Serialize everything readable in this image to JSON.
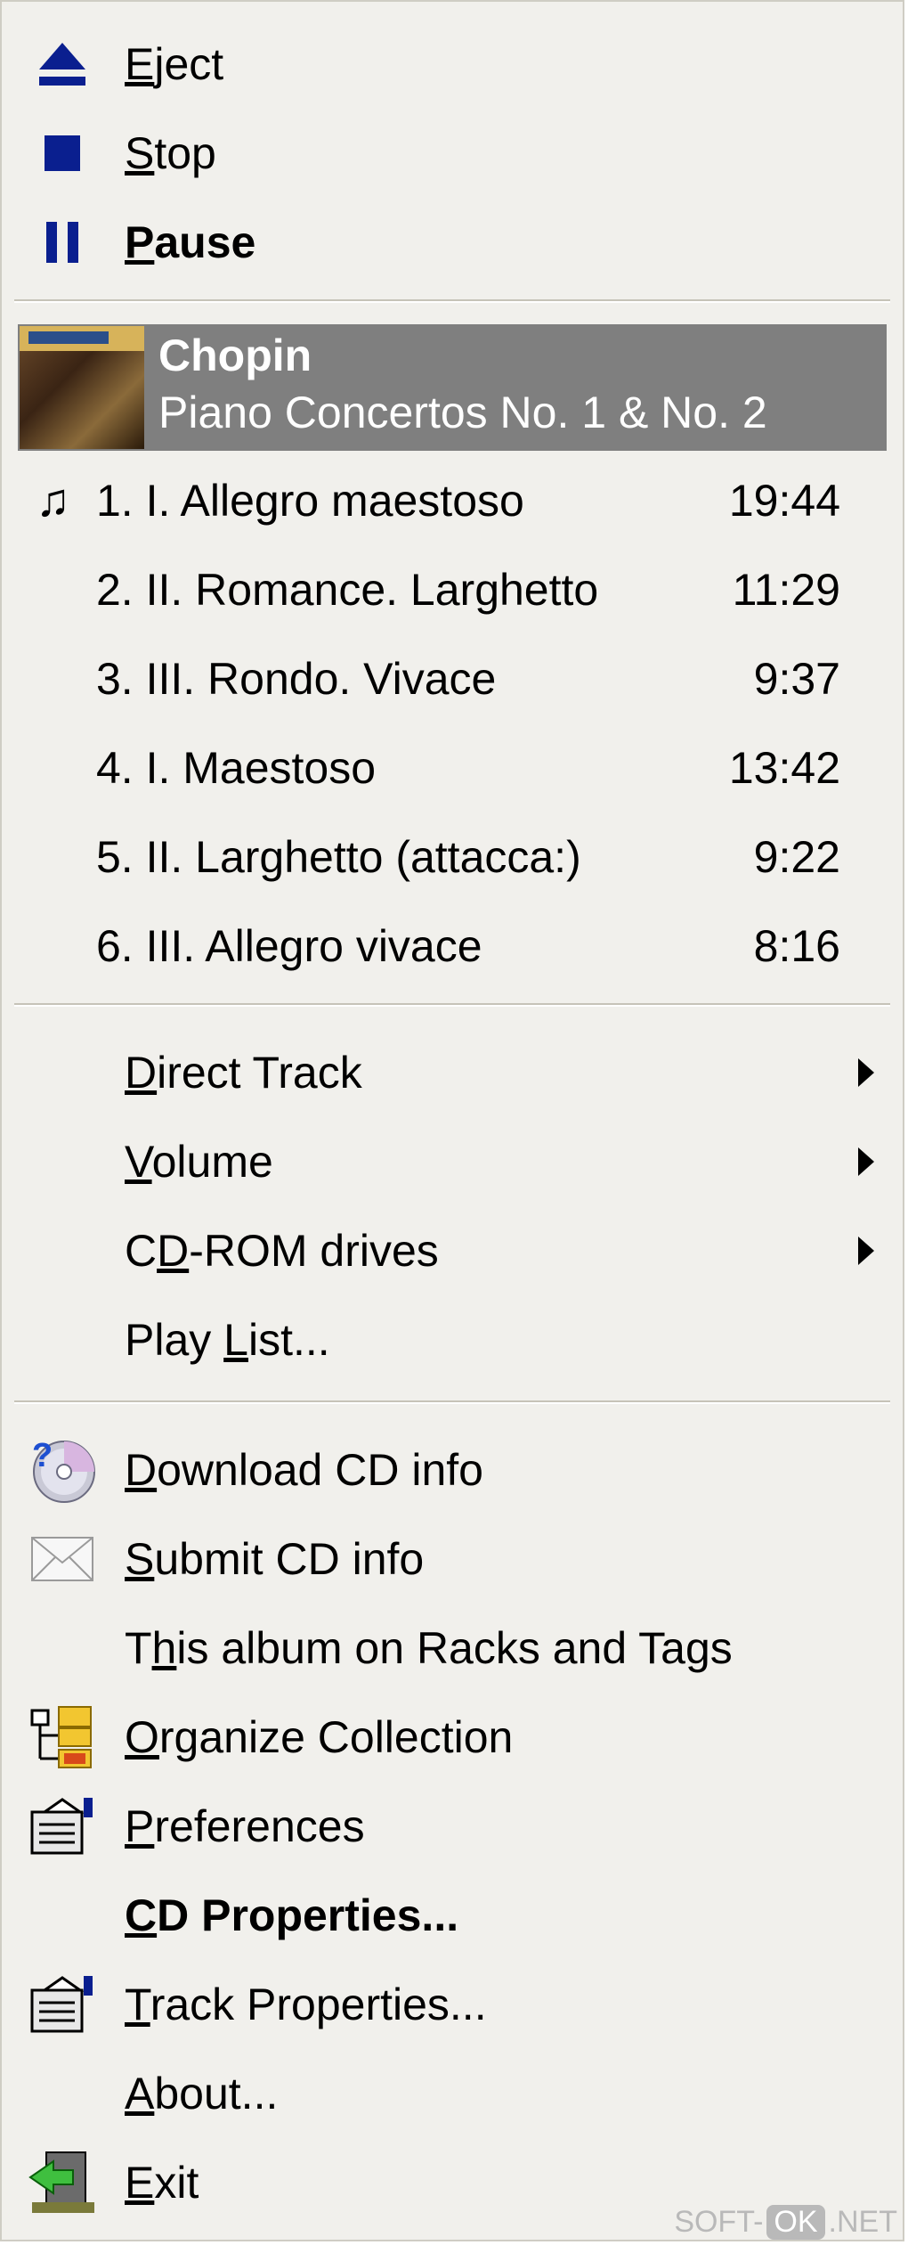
{
  "transport": {
    "eject": {
      "pre": "",
      "key": "E",
      "post": "ject"
    },
    "stop": {
      "pre": "",
      "key": "S",
      "post": "top"
    },
    "pause": {
      "pre": "",
      "key": "P",
      "post": "ause"
    }
  },
  "album": {
    "artist": "Chopin",
    "title": "Piano Concertos No. 1 & No. 2"
  },
  "tracks": [
    {
      "name": "1. I. Allegro maestoso",
      "duration": "19:44"
    },
    {
      "name": "2. II. Romance. Larghetto",
      "duration": "11:29"
    },
    {
      "name": "3. III. Rondo. Vivace",
      "duration": "9:37"
    },
    {
      "name": "4. I. Maestoso",
      "duration": "13:42"
    },
    {
      "name": "5. II. Larghetto (attacca:)",
      "duration": "9:22"
    },
    {
      "name": "6. III. Allegro vivace",
      "duration": "8:16"
    }
  ],
  "current_track_marker": "♫",
  "submenus": {
    "direct_track": {
      "pre": "",
      "key": "D",
      "post": "irect Track"
    },
    "volume": {
      "pre": "",
      "key": "V",
      "post": "olume"
    },
    "cdrom": {
      "pre": "C",
      "key": "D",
      "post": "-ROM drives"
    },
    "playlist": {
      "pre": "Play ",
      "key": "L",
      "post": "ist..."
    }
  },
  "actions": {
    "download": {
      "pre": "",
      "key": "D",
      "post": "ownload CD info"
    },
    "submit": {
      "pre": "",
      "key": "S",
      "post": "ubmit CD info"
    },
    "racks": {
      "pre": "T",
      "key": "h",
      "post": "is album on Racks and Tags"
    },
    "organize": {
      "pre": "",
      "key": "O",
      "post": "rganize Collection"
    },
    "preferences": {
      "pre": "",
      "key": "P",
      "post": "references"
    },
    "cd_properties": {
      "pre": "",
      "key": "C",
      "post": "D Properties..."
    },
    "track_properties": {
      "pre": "",
      "key": "T",
      "post": "rack Properties..."
    },
    "about": {
      "pre": "",
      "key": "A",
      "post": "bout..."
    },
    "exit": {
      "pre": "",
      "key": "E",
      "post": "xit"
    }
  },
  "watermark": {
    "pre": "SOFT-",
    "ok": "OK",
    "post": ".NET"
  },
  "colors": {
    "menu_bg": "#f1f0ec",
    "highlight": "#7f7f7f",
    "icon_blue": "#0a1f8f"
  }
}
